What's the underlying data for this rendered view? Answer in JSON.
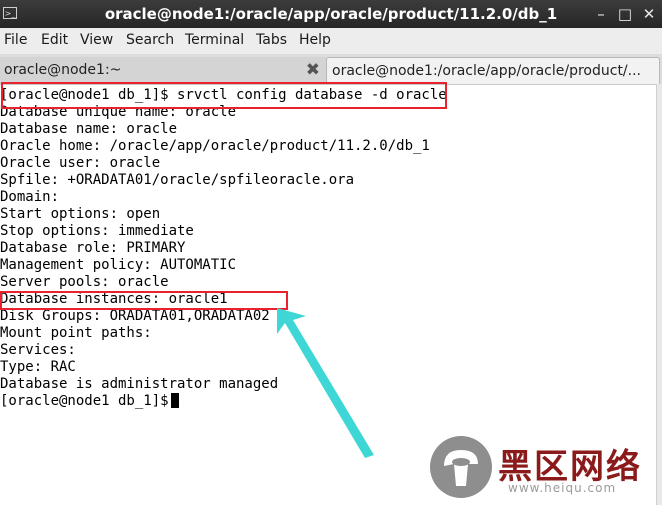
{
  "window": {
    "title": "oracle@node1:/oracle/app/oracle/product/11.2.0/db_1"
  },
  "menu": [
    "File",
    "Edit",
    "View",
    "Search",
    "Terminal",
    "Tabs",
    "Help"
  ],
  "tabs": [
    {
      "label": "oracle@node1:~"
    },
    {
      "label": "oracle@node1:/oracle/app/oracle/product/..."
    }
  ],
  "terminal": {
    "lines": [
      "[oracle@node1 db_1]$ srvctl config database -d oracle",
      "Database unique name: oracle",
      "Database name: oracle",
      "Oracle home: /oracle/app/oracle/product/11.2.0/db_1",
      "Oracle user: oracle",
      "Spfile: +ORADATA01/oracle/spfileoracle.ora",
      "Domain:",
      "Start options: open",
      "Stop options: immediate",
      "Database role: PRIMARY",
      "Management policy: AUTOMATIC",
      "Server pools: oracle",
      "Database instances: oracle1",
      "Disk Groups: ORADATA01,ORADATA02",
      "Mount point paths:",
      "Services:",
      "Type: RAC",
      "Database is administrator managed"
    ],
    "prompt": "[oracle@node1 db_1]$"
  },
  "annotation": {
    "box_color": "#e8232e",
    "arrow_color": "#3fd6d6"
  },
  "watermark": {
    "name": "黑区网络",
    "url": "www.heiqu.com"
  }
}
